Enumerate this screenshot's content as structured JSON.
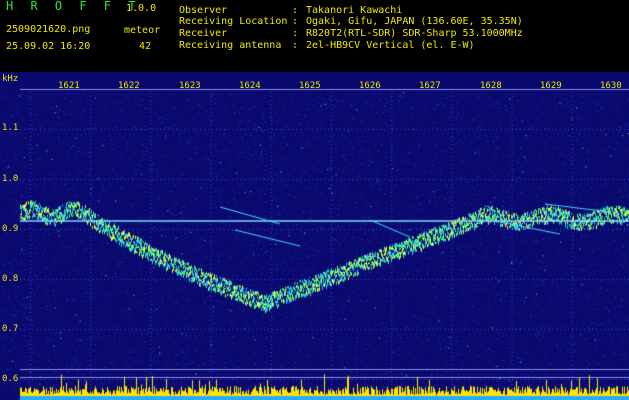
{
  "app": {
    "brand": "H R O F F T",
    "version": "1.0.0"
  },
  "file": {
    "name": "2509021620.png",
    "datetime": "25.09.02 16:20"
  },
  "meteor": {
    "label": "meteor",
    "count": "42"
  },
  "info": [
    {
      "label": "Observer",
      "value": "Takanori Kawachi"
    },
    {
      "label": "Receiving Location",
      "value": "Ogaki, Gifu, JAPAN (136.60E, 35.35N)"
    },
    {
      "label": "Receiver",
      "value": "R820T2(RTL-SDR) SDR-Sharp 53.1000MHz"
    },
    {
      "label": "Receiving antenna",
      "value": "2el-HB9CV Vertical (el. E-W)"
    }
  ],
  "waterfall": {
    "y_unit": "kHz",
    "y_ticks": [
      "1.1",
      "1.0",
      "0.9",
      "0.8",
      "0.7",
      "0.6"
    ],
    "x_ticks": [
      "1621",
      "1622",
      "1623",
      "1624",
      "1625",
      "1626",
      "1627",
      "1628",
      "1629",
      "1630"
    ],
    "colors": {
      "background": "#0a0a6e",
      "grid": "#3a3ad0",
      "carrier": "#7fd8ff",
      "trace": "#3fff7f",
      "level": "#ffe600",
      "level_base": "#28aaff"
    }
  }
}
